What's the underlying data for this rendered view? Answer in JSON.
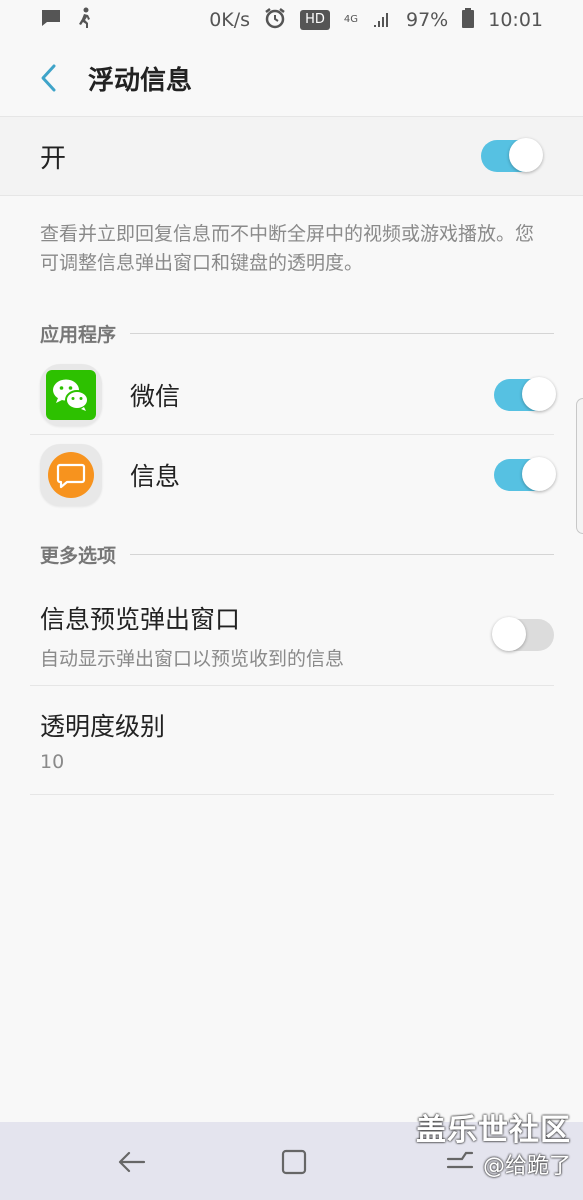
{
  "status_bar": {
    "net_speed": "0K/s",
    "hd_badge": "HD",
    "network": "4G",
    "battery": "97%",
    "time": "10:01",
    "icons": [
      "chat-notification-icon",
      "run-icon",
      "alarm-icon",
      "signal-icon",
      "battery-icon"
    ]
  },
  "header": {
    "title": "浮动信息"
  },
  "master_switch": {
    "label": "开",
    "enabled": true
  },
  "description": "查看并立即回复信息而不中断全屏中的视频或游戏播放。您可调整信息弹出窗口和键盘的透明度。",
  "apps_section": {
    "title": "应用程序",
    "items": [
      {
        "name": "微信",
        "icon": "wechat-icon",
        "enabled": true
      },
      {
        "name": "信息",
        "icon": "messages-icon",
        "enabled": true
      }
    ]
  },
  "more_section": {
    "title": "更多选项",
    "preview": {
      "title": "信息预览弹出窗口",
      "subtitle": "自动显示弹出窗口以预览收到的信息",
      "enabled": false
    },
    "transparency": {
      "title": "透明度级别",
      "value": "10"
    }
  },
  "watermark": {
    "site": "盖乐世社区",
    "user": "@给跪了"
  },
  "colors": {
    "accent": "#56c1e2",
    "wechat": "#2dc100",
    "messages": "#f7931e"
  }
}
